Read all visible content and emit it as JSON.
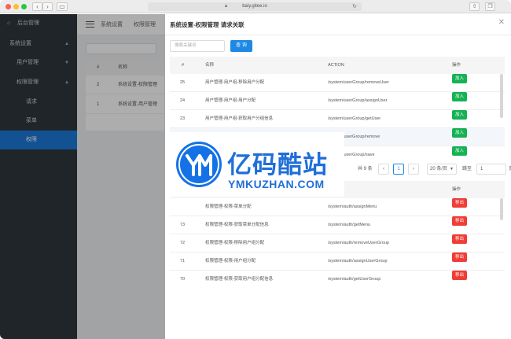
{
  "browser": {
    "url": "baiy.gitee.io"
  },
  "sidebar": {
    "items": [
      {
        "label": "后台管理",
        "icon": "home-icon",
        "expanded": false
      },
      {
        "label": "系统设置",
        "expanded": true
      },
      {
        "label": "用户管理",
        "expanded": true
      },
      {
        "label": "权限管理",
        "expanded": true
      },
      {
        "label": "请求"
      },
      {
        "label": "菜单"
      },
      {
        "label": "权限",
        "active": true
      }
    ]
  },
  "background_page": {
    "breadcrumb": [
      "系统设置",
      "权限管理"
    ],
    "table_headers": [
      "#",
      "名称"
    ],
    "rows": [
      {
        "id": "2",
        "name": "系统设置-权限管理"
      },
      {
        "id": "1",
        "name": "系统设置-用户管理"
      }
    ]
  },
  "dialog": {
    "title": "系统设置-权限管理 请求关联",
    "search_placeholder": "搜索关键词",
    "query_button": "查 询",
    "headers": [
      "#",
      "名称",
      "ACTION",
      "操作"
    ],
    "top_rows": [
      {
        "id": "25",
        "name": "用户管理-用户组-移除用户分配",
        "action": "/system/userGroup/removeUser",
        "op": "加入"
      },
      {
        "id": "24",
        "name": "用户管理-用户组-用户分配",
        "action": "/system/userGroup/assignUser",
        "op": "加入"
      },
      {
        "id": "23",
        "name": "用户管理-用户组-获取用户分组信息",
        "action": "/system/userGroup/getUser",
        "op": "加入"
      },
      {
        "id": "",
        "name": "",
        "action": "/system/userGroup/remove",
        "op": "加入"
      },
      {
        "id": "",
        "name": "",
        "action": "/system/userGroup/save",
        "op": "加入"
      }
    ],
    "pager": {
      "total": "共 9 条",
      "current": "1",
      "page_size": "20 条/页",
      "jump_label": "跳至",
      "jump_value": "1",
      "page_suffix": "页"
    },
    "bottom_rows": [
      {
        "id": "",
        "name": "权限管理-权限-菜单分配",
        "action": "/system/auth/assignMenu",
        "op": "移出"
      },
      {
        "id": "73",
        "name": "权限管理-权限-获取菜单分配信息",
        "action": "/system/auth/getMenu",
        "op": "移出"
      },
      {
        "id": "72",
        "name": "权限管理-权限-移除用户组分配",
        "action": "/system/auth/removeUserGroup",
        "op": "移出"
      },
      {
        "id": "71",
        "name": "权限管理-权限-用户组分配",
        "action": "/system/auth/assignUserGroup",
        "op": "移出"
      },
      {
        "id": "70",
        "name": "权限管理-权限-获取用户组分配信息",
        "action": "/system/auth/getUserGroup",
        "op": "移出"
      }
    ]
  },
  "watermark": {
    "cn": "亿码酷站",
    "en": "YMKUZHAN.COM"
  },
  "colors": {
    "sidebar_bg": "#30373f",
    "active": "#1d7ad8",
    "add": "#16b254",
    "remove": "#ef3e36",
    "primary": "#1e88e5",
    "watermark": "#1f6fd8"
  }
}
